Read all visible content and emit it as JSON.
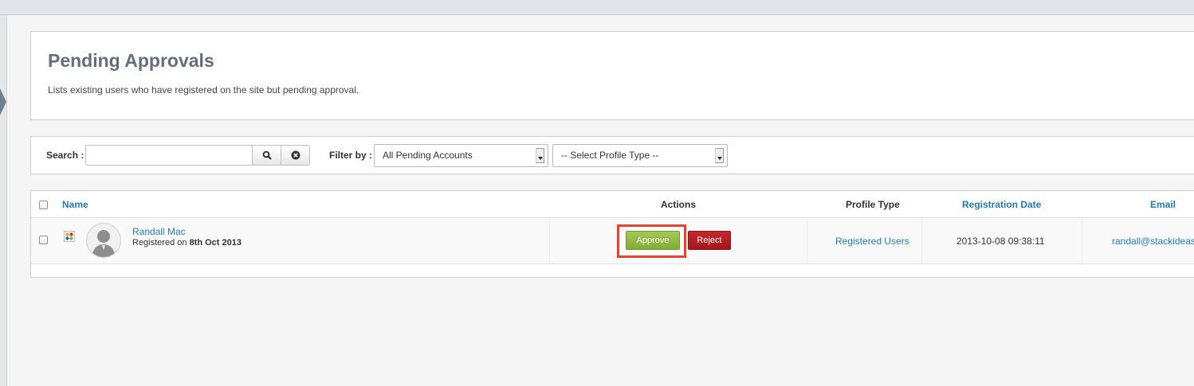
{
  "header": {
    "title": "Pending Approvals",
    "description": "Lists existing users who have registered on the site but pending approval."
  },
  "toolbar": {
    "search_label": "Search :",
    "search_value": "",
    "search_icon": "magnifier-icon",
    "clear_icon": "clear-circle-x-icon",
    "filter_label": "Filter by :",
    "filter_selected": "All Pending Accounts",
    "profile_type_selected": "-- Select Profile Type --"
  },
  "table": {
    "columns": {
      "name": "Name",
      "actions": "Actions",
      "profile_type": "Profile Type",
      "registration_date": "Registration Date",
      "email": "Email"
    },
    "rows": [
      {
        "name": "Randall Mac",
        "registered_prefix": "Registered on",
        "registered_date": "8th Oct 2013",
        "approve_label": "Approve",
        "reject_label": "Reject",
        "profile_type": "Registered Users",
        "registration_date": "2013-10-08 09:38:11",
        "email": "randall@stackideas"
      }
    ]
  },
  "colors": {
    "link": "#1f7bbf",
    "title": "#636d7c",
    "approve": "#8fb33c",
    "reject": "#b31e22",
    "highlight": "#e8432c"
  }
}
